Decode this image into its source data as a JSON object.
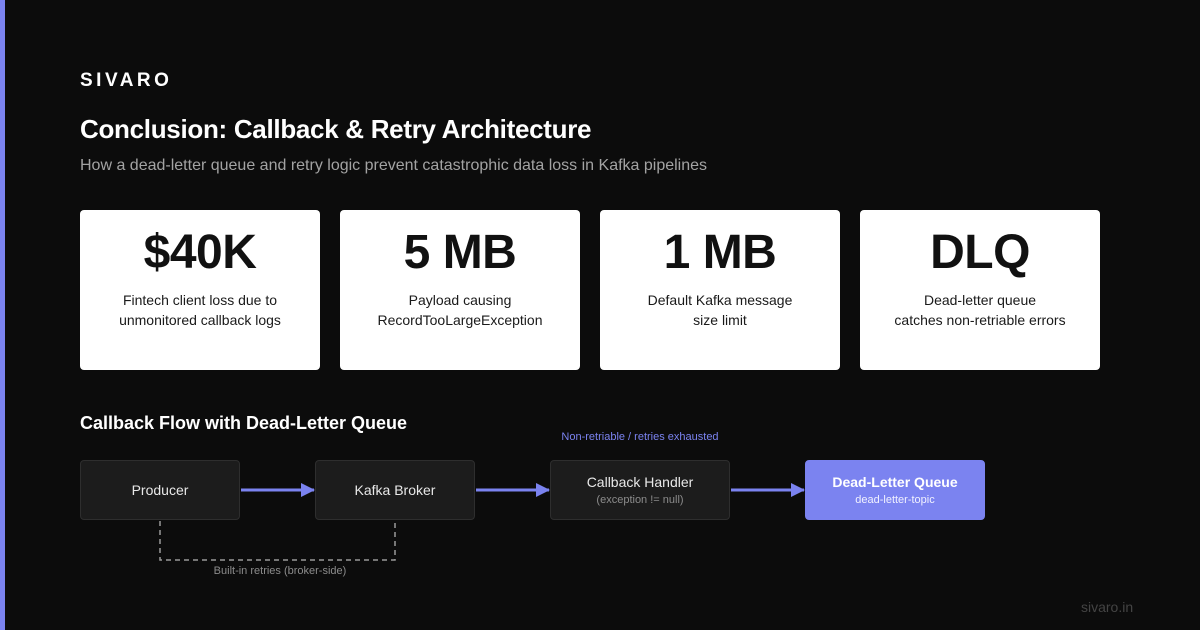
{
  "brand": "SIVARO",
  "title": "Conclusion: Callback & Retry Architecture",
  "subtitle": "How a dead-letter queue and retry logic prevent catastrophic data loss in Kafka pipelines",
  "cards": [
    {
      "value": "$40K",
      "desc_line1": "Fintech client loss due to",
      "desc_line2": "unmonitored callback logs"
    },
    {
      "value": "5 MB",
      "desc_line1": "Payload causing",
      "desc_line2": "RecordTooLargeException"
    },
    {
      "value": "1 MB",
      "desc_line1": "Default Kafka message",
      "desc_line2": "size limit"
    },
    {
      "value": "DLQ",
      "desc_line1": "Dead-letter queue",
      "desc_line2": "catches non-retriable errors"
    }
  ],
  "diagram": {
    "section_title": "Callback Flow with Dead-Letter Queue",
    "nodes": {
      "producer": {
        "label": "Producer"
      },
      "broker": {
        "label": "Kafka Broker"
      },
      "handler": {
        "label": "Callback Handler",
        "sublabel": "(exception != null)"
      },
      "dlq": {
        "label": "Dead-Letter Queue",
        "sublabel": "dead-letter-topic"
      }
    },
    "edge_labels": {
      "handler_to_dlq": "Non-retriable / retries exhausted",
      "retry_loop": "Built-in retries (broker-side)"
    }
  },
  "footer": "sivaro.in",
  "colors": {
    "background": "#0c0c0c",
    "accent": "#7b83f0",
    "card_bg": "#ffffff",
    "node_bg": "#1c1c1c",
    "muted_text": "#a3a3a3"
  }
}
